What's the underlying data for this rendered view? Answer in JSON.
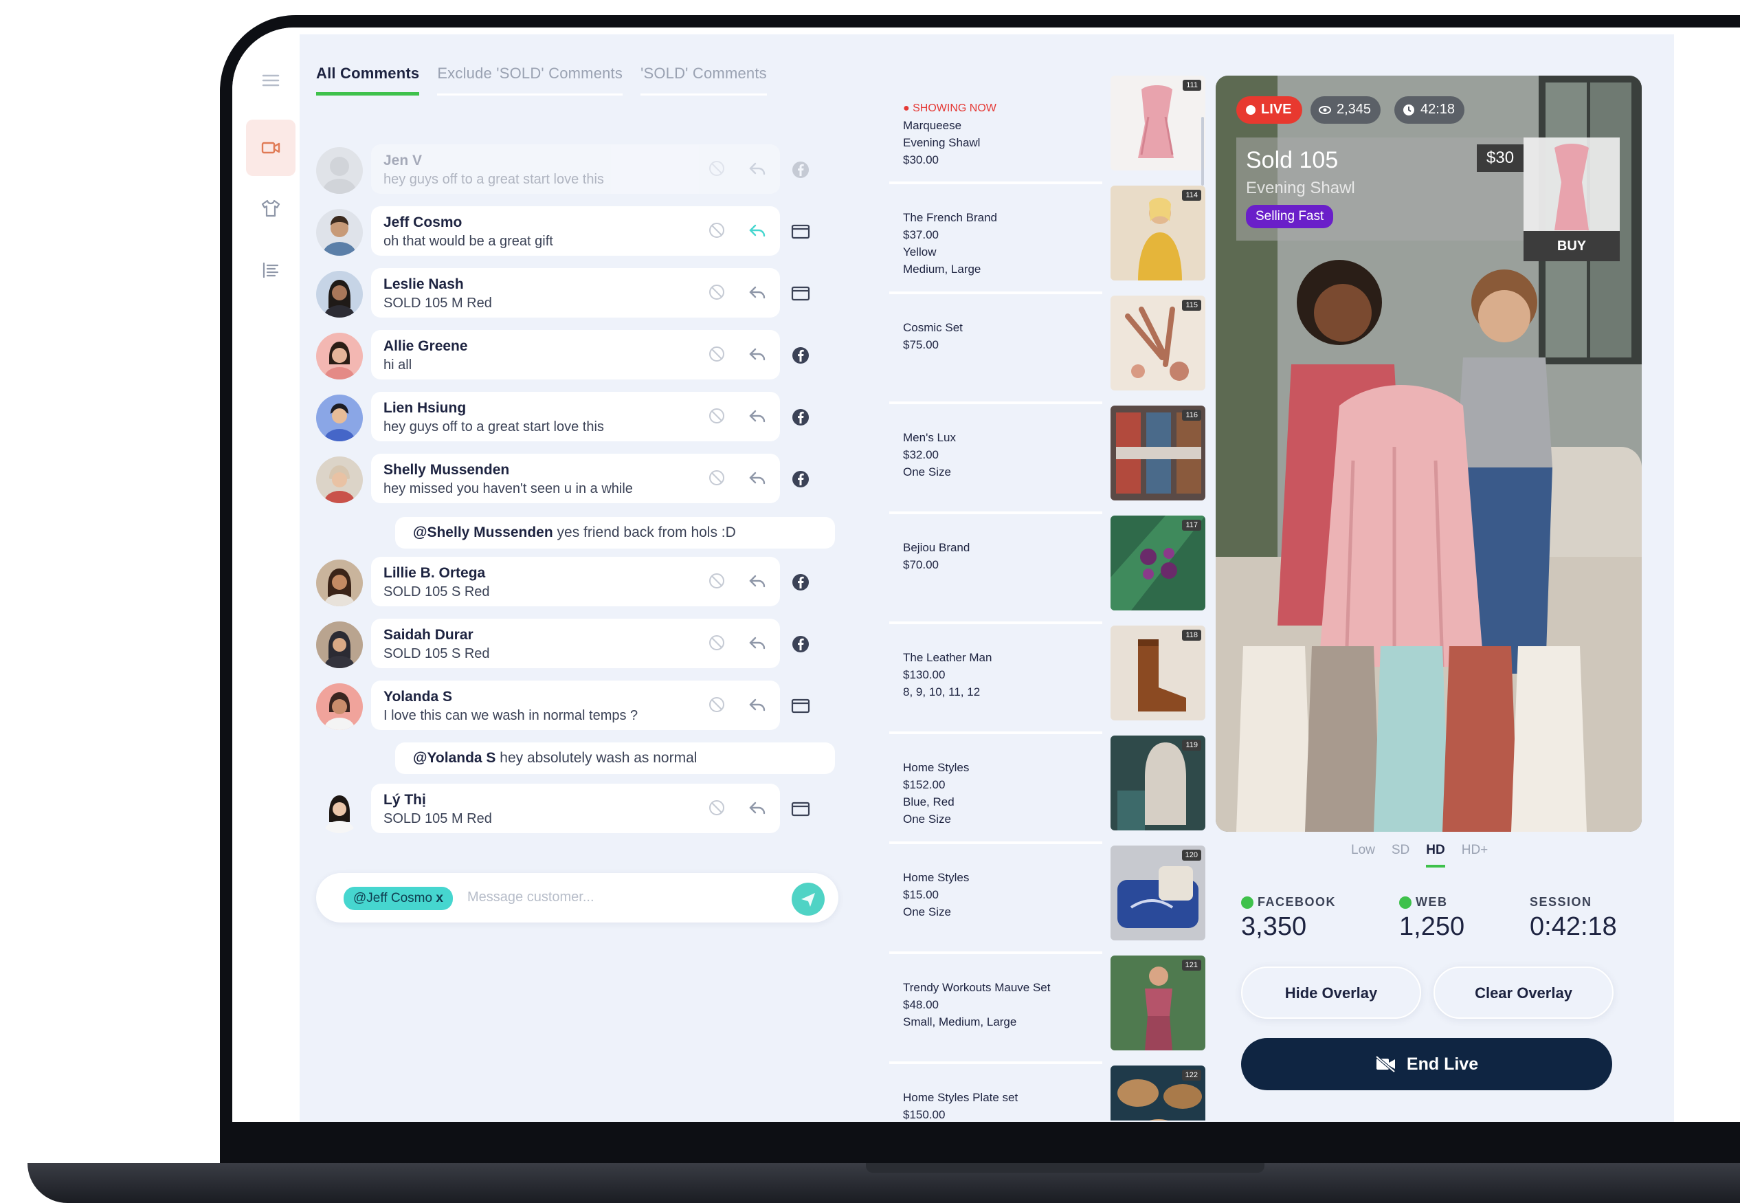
{
  "tabs": [
    {
      "label": "All Comments",
      "active": true
    },
    {
      "label": "Exclude 'SOLD' Comments",
      "active": false
    },
    {
      "label": "'SOLD' Comments",
      "active": false
    }
  ],
  "comments": [
    {
      "name": "Jen V",
      "text": "hey guys off to a great start love this",
      "source": "facebook",
      "faded": true
    },
    {
      "name": "Jeff Cosmo",
      "text": "oh that would be a great gift",
      "source": "web",
      "reply_active": true
    },
    {
      "name": "Leslie Nash",
      "text": "SOLD 105 M Red",
      "source": "web"
    },
    {
      "name": "Allie Greene",
      "text": "hi all",
      "source": "facebook"
    },
    {
      "name": "Lien Hsiung",
      "text": "hey guys off to a great start love this",
      "source": "facebook"
    },
    {
      "name": "Shelly Mussenden",
      "text": "hey missed you haven't seen u in a while",
      "source": "facebook"
    },
    {
      "name": "Lillie B. Ortega",
      "text": "SOLD 105 S Red",
      "source": "facebook"
    },
    {
      "name": "Saidah Durar",
      "text": "SOLD 105 S Red",
      "source": "facebook"
    },
    {
      "name": "Yolanda S",
      "text": "I love this can we wash in normal temps ?",
      "source": "web"
    },
    {
      "name": "Lý Thị",
      "text": "SOLD 105 M Red",
      "source": "web"
    }
  ],
  "replies": [
    {
      "mention": "@Shelly Mussenden",
      "text": "yes friend back from hols :D"
    },
    {
      "mention": "@Yolanda S",
      "text": "hey absolutely wash as normal"
    }
  ],
  "composer": {
    "chip": "@Jeff Cosmo",
    "chip_close": "x",
    "placeholder": "Message customer..."
  },
  "products": [
    {
      "now_label": "SHOWING NOW",
      "lines": "Marqueese\nEvening Shawl\n$30.00",
      "badge": "111"
    },
    {
      "lines": "The French Brand\n$37.00\nYellow\nMedium, Large",
      "badge": "114"
    },
    {
      "lines": "Cosmic Set\n$75.00",
      "badge": "115"
    },
    {
      "lines": "Men's Lux\n$32.00\nOne Size",
      "badge": "116"
    },
    {
      "lines": "Bejiou Brand\n$70.00",
      "badge": "117"
    },
    {
      "lines": "The Leather Man\n$130.00\n8, 9, 10, 11, 12",
      "badge": "118"
    },
    {
      "lines": "Home Styles\n$152.00\nBlue, Red\nOne Size",
      "badge": "119"
    },
    {
      "lines": "Home Styles\n$15.00\nOne Size",
      "badge": "120"
    },
    {
      "lines": "Trendy Workouts Mauve Set\n$48.00\nSmall, Medium, Large",
      "badge": "121"
    },
    {
      "lines": "Home Styles Plate set\n$150.00",
      "badge": "122"
    }
  ],
  "video": {
    "live_label": "LIVE",
    "viewers": "2,345",
    "duration": "42:18",
    "sold_title": "Sold 105",
    "sold_subtitle": "Evening Shawl",
    "selling_fast": "Selling Fast",
    "price": "$30",
    "buy_label": "BUY"
  },
  "quality": {
    "options": [
      "Low",
      "SD",
      "HD",
      "HD+"
    ],
    "selected": "HD"
  },
  "stats": {
    "facebook_label": "FACEBOOK",
    "facebook_value": "3,350",
    "web_label": "WEB",
    "web_value": "1,250",
    "session_label": "SESSION",
    "session_value": "0:42:18"
  },
  "buttons": {
    "hide_overlay": "Hide Overlay",
    "clear_overlay": "Clear Overlay",
    "end_live": "End Live"
  },
  "colors": {
    "accent_green": "#3ec14b",
    "live_red": "#e53935",
    "navy": "#0f2542",
    "teal": "#46d6cf",
    "selling_fast_purple": "#6a1fc9",
    "panel_bg": "#eef2fa"
  }
}
